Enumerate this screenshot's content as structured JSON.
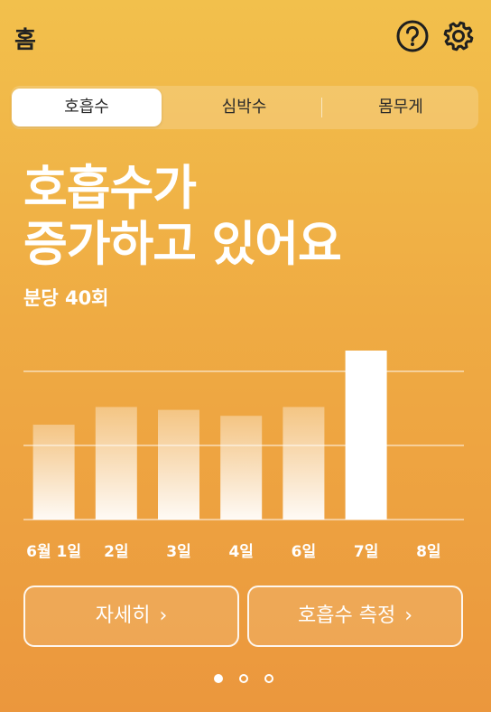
{
  "header": {
    "title": "홈"
  },
  "tabs": [
    {
      "label": "호흡수",
      "active": true
    },
    {
      "label": "심박수",
      "active": false
    },
    {
      "label": "몸무게",
      "active": false
    }
  ],
  "headline": {
    "line1": "호흡수가",
    "line2": "증가하고 있어요"
  },
  "subtitle": "분당 40회",
  "chart_data": {
    "type": "bar",
    "categories": [
      "6월 1일",
      "2일",
      "3일",
      "4일",
      "6일",
      "7일",
      "8일"
    ],
    "values": [
      32,
      38,
      37,
      35,
      38,
      57,
      null
    ],
    "ylim": [
      0,
      50
    ],
    "grid": true,
    "highlight_index": 5
  },
  "buttons": {
    "detail": "자세히",
    "measure": "호흡수 측정"
  },
  "pager": {
    "count": 3,
    "active": 0
  },
  "icons": {
    "help": "help-circle-icon",
    "settings": "gear-icon",
    "chevron": "chevron-right-icon"
  }
}
